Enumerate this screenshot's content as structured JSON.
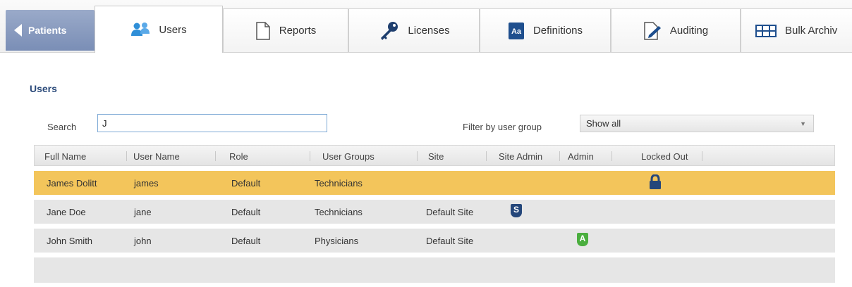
{
  "tabs": {
    "back_label": "Patients",
    "users": "Users",
    "reports": "Reports",
    "licenses": "Licenses",
    "definitions": "Definitions",
    "auditing": "Auditing",
    "bulk_archive": "Bulk Archiv"
  },
  "icons": {
    "users": "users-icon",
    "reports": "document-icon",
    "licenses": "key-icon",
    "definitions": "aa-dictionary-icon",
    "auditing": "pen-edit-icon",
    "bulk_archive": "grid-table-icon",
    "locked": "padlock-icon"
  },
  "colors": {
    "back_tab": "#8798c0",
    "selected_row": "#f3c55b",
    "row": "#e6e6e6",
    "title": "#2b4a7a",
    "site_admin_badge": "#24467a",
    "admin_badge": "#4aae3e",
    "lock": "#24467a"
  },
  "page": {
    "title": "Users"
  },
  "search": {
    "label": "Search",
    "value": "J"
  },
  "filter": {
    "label": "Filter by user group",
    "value": "Show all"
  },
  "table": {
    "columns": {
      "full_name": "Full Name",
      "user_name": "User Name",
      "role": "Role",
      "user_groups": "User Groups",
      "site": "Site",
      "site_admin": "Site Admin",
      "admin": "Admin",
      "locked_out": "Locked Out"
    },
    "rows": [
      {
        "full_name": "James Dolitt",
        "user_name": "james",
        "role": "Default",
        "user_groups": "Technicians",
        "site": "",
        "site_admin": "",
        "admin": "",
        "locked_out": true,
        "selected": true
      },
      {
        "full_name": "Jane Doe",
        "user_name": "jane",
        "role": "Default",
        "user_groups": "Technicians",
        "site": "Default Site",
        "site_admin": "S",
        "admin": "",
        "locked_out": false
      },
      {
        "full_name": "John Smith",
        "user_name": "john",
        "role": "Default",
        "user_groups": "Physicians",
        "site": "Default Site",
        "site_admin": "",
        "admin": "A",
        "locked_out": false
      }
    ]
  }
}
